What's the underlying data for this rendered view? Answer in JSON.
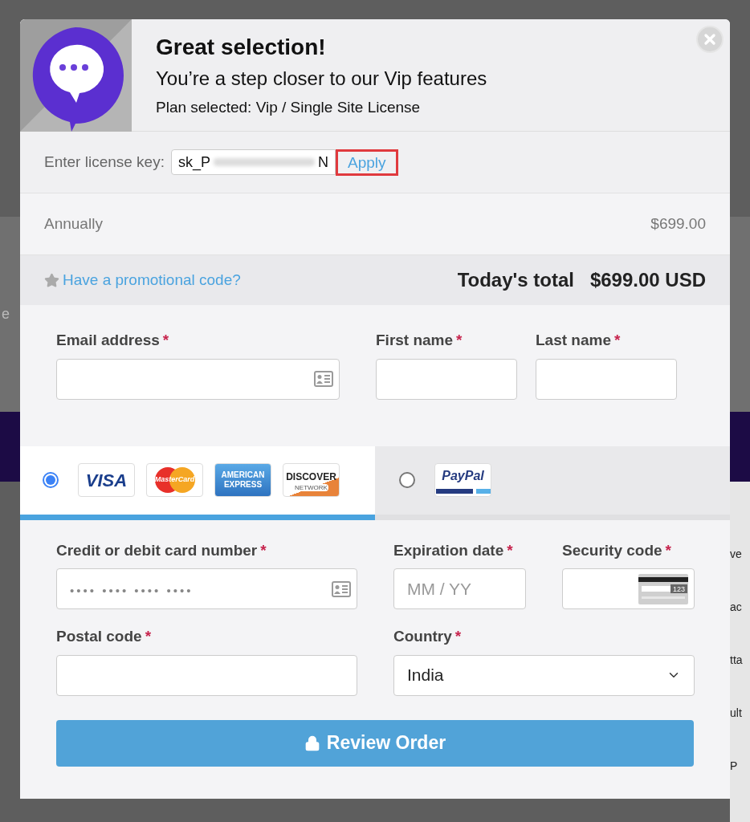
{
  "background": {
    "left_fragments": [
      "e"
    ],
    "right_fragments": [
      "ve",
      "ac",
      "tta",
      "ult",
      "P"
    ]
  },
  "header": {
    "title": "Great selection!",
    "subtitle": "You’re a step closer to our Vip features",
    "plan": "Plan selected: Vip / Single Site License"
  },
  "license": {
    "label": "Enter license key:",
    "value_start": "sk_P",
    "value_end": "N",
    "button": "Apply",
    "highlighted": true
  },
  "billing": {
    "period": "Annually",
    "price": "$699.00"
  },
  "promo": {
    "link": "Have a promotional code?",
    "total_label": "Today's total",
    "total": "$699.00 USD"
  },
  "contact_fields": [
    {
      "label": "Email address",
      "required": "*",
      "kind": "email"
    },
    {
      "label": "First name",
      "required": "*",
      "kind": "plain"
    },
    {
      "label": "Last name",
      "required": "*",
      "kind": "plain"
    }
  ],
  "payment_methods": [
    {
      "kind": "card",
      "selected": true,
      "logos": [
        {
          "kind": "visa",
          "text": "VISA"
        },
        {
          "kind": "mastercard",
          "text": "MasterCard"
        },
        {
          "kind": "amex",
          "text": "AMERICAN EXPRESS"
        },
        {
          "kind": "discover",
          "text": "DISCOVER",
          "subtext": "NETWORK"
        }
      ]
    },
    {
      "kind": "paypal",
      "selected": false,
      "logos": [
        {
          "kind": "paypal",
          "text": "PayPal"
        }
      ]
    }
  ],
  "card_fields": [
    {
      "label": "Credit or debit card number",
      "required": "*",
      "kind": "card",
      "placeholder": "•••• •••• •••• ••••"
    },
    {
      "label": "Expiration date",
      "required": "*",
      "kind": "plain",
      "placeholder": "MM / YY"
    },
    {
      "label": "Security code",
      "required": "*",
      "kind": "cvc",
      "icon_text": "123"
    }
  ],
  "address_fields": [
    {
      "label": "Postal code",
      "required": "*",
      "kind": "plain"
    },
    {
      "label": "Country",
      "required": "*",
      "kind": "select",
      "value": "India"
    }
  ],
  "submit": {
    "label": "Review Order"
  }
}
